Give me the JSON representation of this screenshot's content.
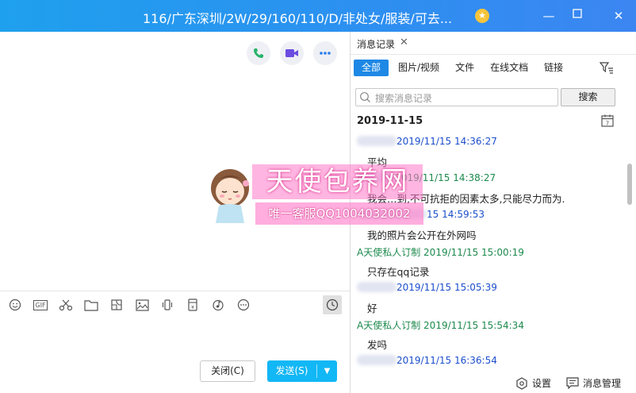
{
  "window": {
    "title": "116/广东深圳/2W/29/160/110/D/非处女/服装/可去...",
    "minimize": "—",
    "maximize": "☐",
    "close": "✕"
  },
  "colors": {
    "titlebar": "#2d8ff0",
    "accent": "#1e88e5",
    "send": "#12b7f5",
    "sender_blue": "#1c4fcc",
    "sender_green": "#1d8a4d"
  },
  "left": {
    "call_buttons": [
      "phone-icon",
      "video-icon",
      "more-icon"
    ],
    "toolbar_icons": [
      "emoji-icon",
      "gif-icon",
      "scissors-icon",
      "folder-icon",
      "sticker-icon",
      "image-icon",
      "shake-icon",
      "red-packet-icon",
      "music-icon",
      "more-options-icon"
    ],
    "gif_label": "GIF",
    "close_label": "关闭(C)",
    "send_label": "发送(S)"
  },
  "watermark": {
    "title": "天使包养网",
    "subtitle": "唯一客服QQ1004032002"
  },
  "history": {
    "tab_label": "消息记录",
    "filters": [
      "全部",
      "图片/视频",
      "文件",
      "在线文档",
      "链接"
    ],
    "search_placeholder": "搜索消息记录",
    "search_button": "搜索",
    "date_header": "2019-11-15",
    "messages": [
      {
        "sender": "",
        "time": "2019/11/15 14:36:27",
        "text": "平均",
        "color": "blue"
      },
      {
        "sender": "A",
        "time": "2019/11/15 14:38:27",
        "text": "我会…到,不可抗拒的因素太多,只能尽力而为.",
        "color": "green"
      },
      {
        "sender": "",
        "time": "15 14:59:53",
        "text": "我的照片会公开在外网吗",
        "color": "blue"
      },
      {
        "sender": "A天使私人订制",
        "time": "2019/11/15 15:00:19",
        "text": "只存在qq记录",
        "color": "green"
      },
      {
        "sender": "",
        "time": "2019/11/15 15:05:39",
        "text": "好",
        "color": "blue"
      },
      {
        "sender": "A天使私人订制",
        "time": "2019/11/15 15:54:34",
        "text": "发吗",
        "color": "green"
      },
      {
        "sender": "",
        "time": "2019/11/15 16:36:54",
        "text": "",
        "color": "blue"
      }
    ],
    "settings_label": "设置",
    "manage_label": "消息管理"
  }
}
